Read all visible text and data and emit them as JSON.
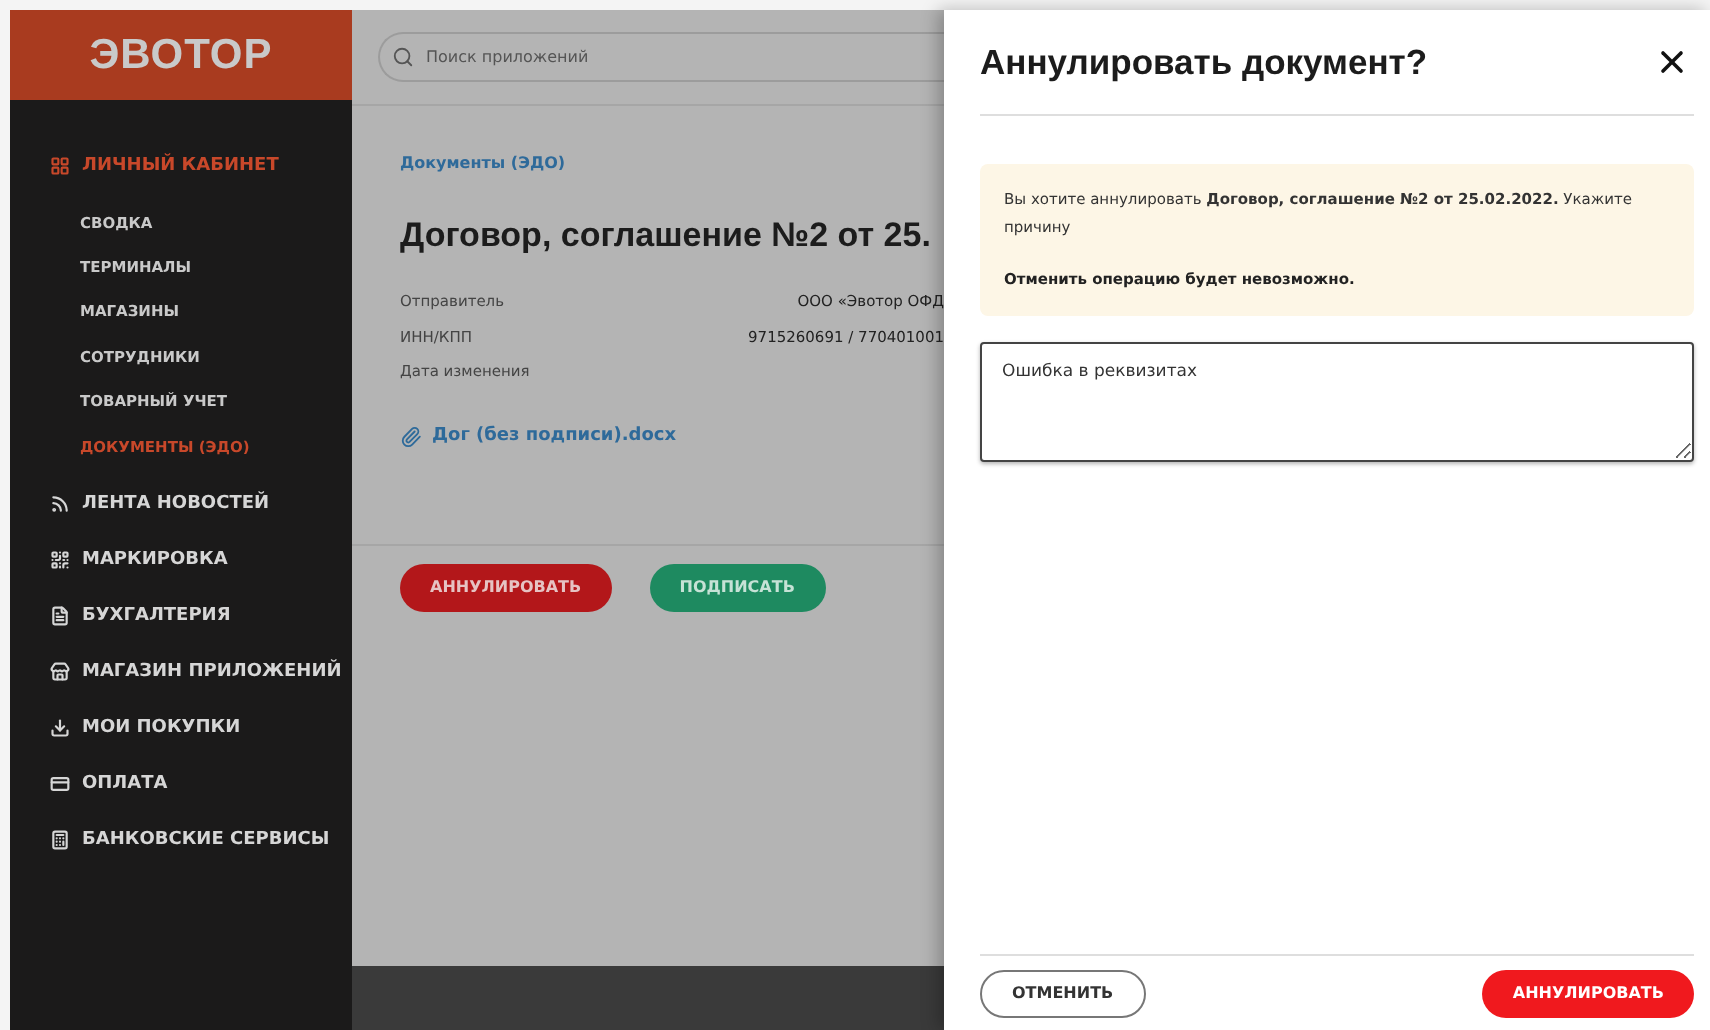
{
  "sidebar": {
    "logo": "ЭВОТОР",
    "sections": [
      {
        "label": "ЛИЧНЫЙ КАБИНЕТ",
        "selected": true,
        "children": [
          {
            "label": "СВОДКА",
            "selected": false
          },
          {
            "label": "ТЕРМИНАЛЫ",
            "selected": false
          },
          {
            "label": "МАГАЗИНЫ",
            "selected": false
          },
          {
            "label": "СОТРУДНИКИ",
            "selected": false
          },
          {
            "label": "ТОВАРНЫЙ УЧЕТ",
            "selected": false
          },
          {
            "label": "ДОКУМЕНТЫ (ЭДО)",
            "selected": true
          }
        ]
      },
      {
        "label": "ЛЕНТА НОВОСТЕЙ",
        "selected": false
      },
      {
        "label": "МАРКИРОВКА",
        "selected": false
      },
      {
        "label": "БУХГАЛТЕРИЯ",
        "selected": false
      },
      {
        "label": "МАГАЗИН ПРИЛОЖЕНИЙ",
        "selected": false
      },
      {
        "label": "МОИ ПОКУПКИ",
        "selected": false
      },
      {
        "label": "ОПЛАТА",
        "selected": false
      },
      {
        "label": "БАНКОВСКИЕ СЕРВИСЫ",
        "selected": false
      }
    ]
  },
  "search": {
    "placeholder": "Поиск приложений"
  },
  "document": {
    "breadcrumb": "Документы (ЭДО)",
    "title": "Договор, соглашение №2 от 25.",
    "details": [
      {
        "label": "Отправитель",
        "value": "ООО «Эвотор ОФД"
      },
      {
        "label": "ИНН/КПП",
        "value": "9715260691 / 770401001"
      },
      {
        "label": "Дата изменения"
      }
    ],
    "attachment": "Дог (без подписи).docx",
    "actions": [
      {
        "label": "АННУЛИРОВАТЬ",
        "kind": "danger"
      },
      {
        "label": "ПОДПИСАТЬ",
        "kind": "success"
      }
    ]
  },
  "dialog": {
    "title": "Аннулировать документ?",
    "notice": "Вы хотите аннулировать **Договор, соглашение №2 от 25.02.2022.** Укажите причину",
    "warning": "Отменить операцию будет невозможно.",
    "reason": "Ошибка в реквизитах",
    "buttons": [
      {
        "label": "ОТМЕНИТЬ",
        "kind": "secondary"
      },
      {
        "label": "АННУЛИРОВАТЬ",
        "kind": "primary"
      }
    ]
  }
}
